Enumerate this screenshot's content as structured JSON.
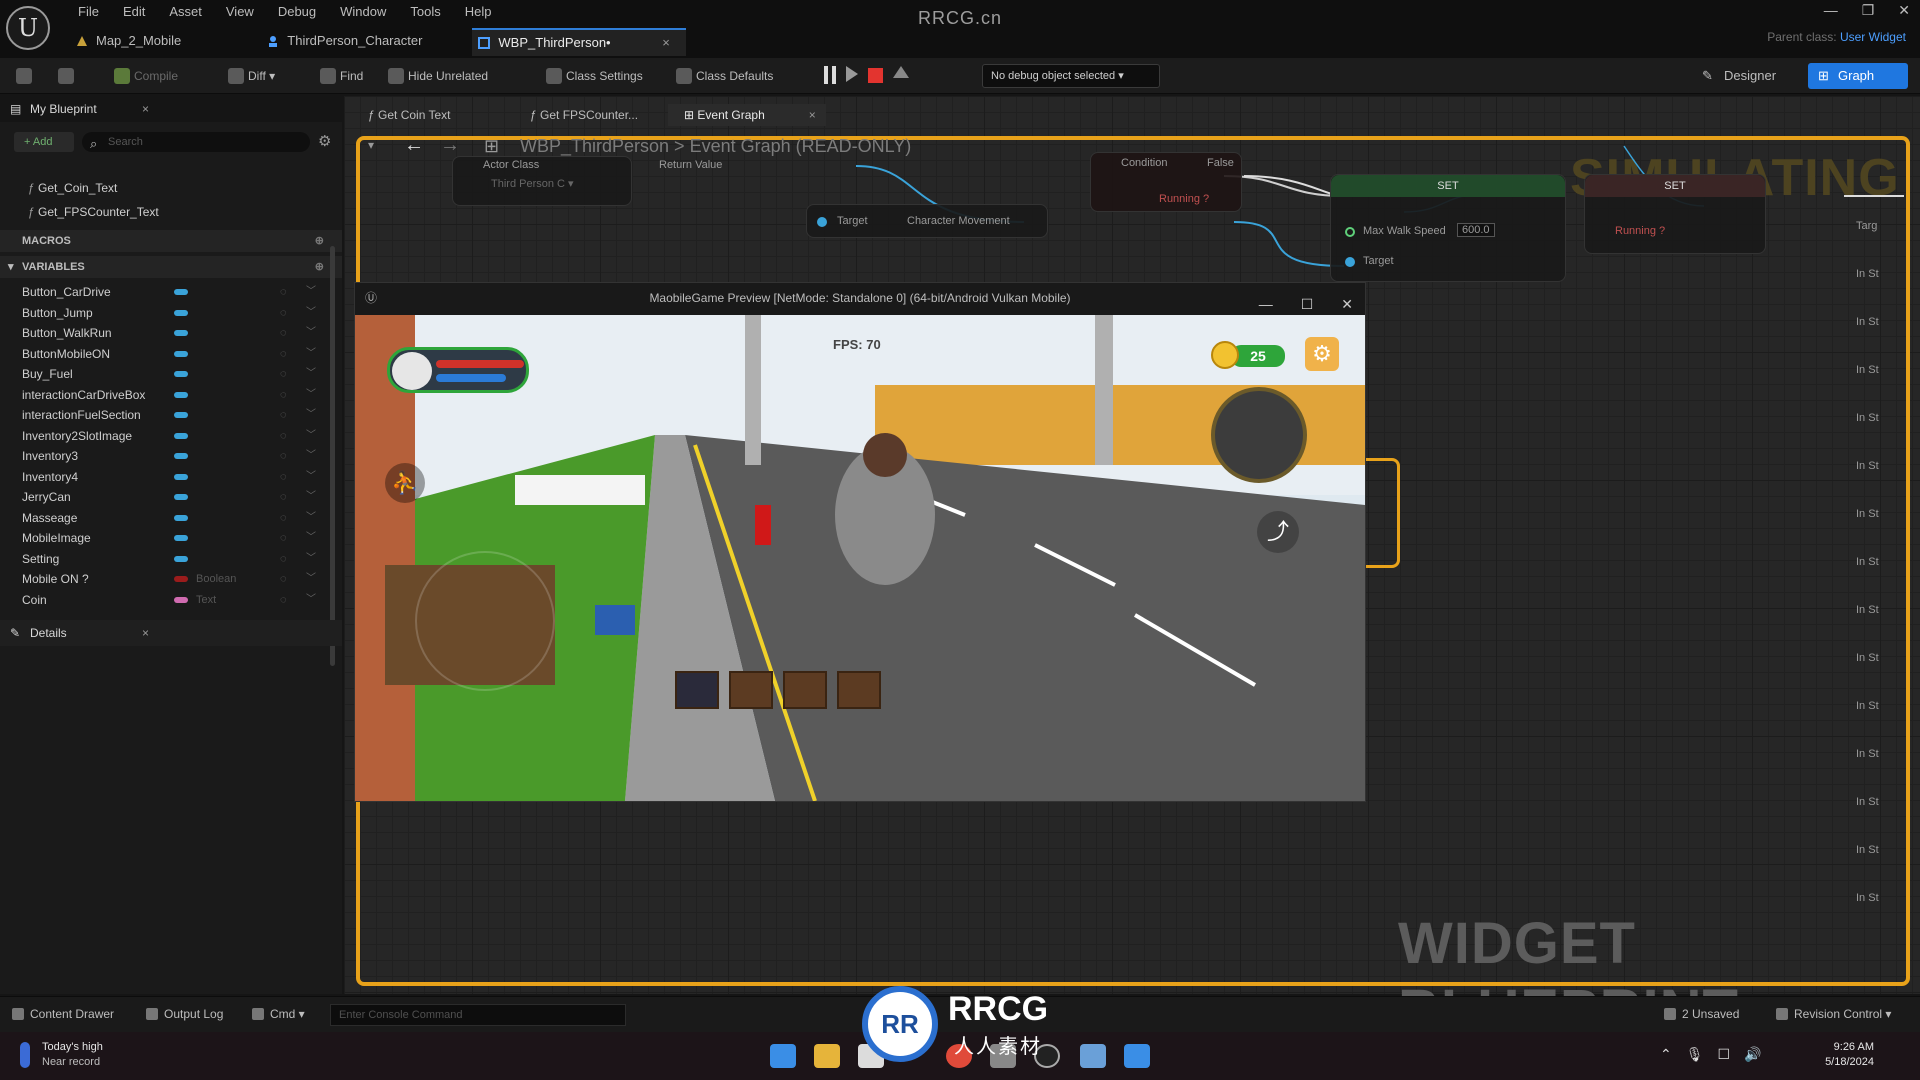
{
  "app": {
    "title": "RRCG.cn",
    "parent_class_label": "Parent class:",
    "parent_class_value": "User Widget",
    "menu": [
      "File",
      "Edit",
      "Asset",
      "View",
      "Debug",
      "Window",
      "Tools",
      "Help"
    ],
    "tabs": [
      {
        "label": "Map_2_Mobile"
      },
      {
        "label": "ThirdPerson_Character"
      },
      {
        "label": "WBP_ThirdPerson•",
        "close": "×"
      }
    ]
  },
  "toolbar": {
    "compile": "Compile",
    "diff": "Diff",
    "find": "Find",
    "hide_unrelated": "Hide Unrelated",
    "class_settings": "Class Settings",
    "class_defaults": "Class Defaults",
    "debug_object": "No debug object selected",
    "designer": "Designer",
    "graph": "Graph"
  },
  "my_blueprint": {
    "title": "My Blueprint",
    "add": "+ Add",
    "search_placeholder": "Search",
    "functions": [
      "Get_Coin_Text",
      "Get_FPSCounter_Text"
    ],
    "macros_label": "MACROS",
    "variables_label": "VARIABLES",
    "variables": [
      {
        "name": "Button_CarDrive",
        "type": ""
      },
      {
        "name": "Button_Jump",
        "type": ""
      },
      {
        "name": "Button_WalkRun",
        "type": ""
      },
      {
        "name": "ButtonMobileON",
        "type": ""
      },
      {
        "name": "Buy_Fuel",
        "type": ""
      },
      {
        "name": "interactionCarDriveBox",
        "type": ""
      },
      {
        "name": "interactionFuelSection",
        "type": ""
      },
      {
        "name": "Inventory2SlotImage",
        "type": ""
      },
      {
        "name": "Inventory3",
        "type": ""
      },
      {
        "name": "Inventory4",
        "type": ""
      },
      {
        "name": "JerryCan",
        "type": ""
      },
      {
        "name": "Masseage",
        "type": ""
      },
      {
        "name": "MobileImage",
        "type": ""
      },
      {
        "name": "Setting",
        "type": ""
      },
      {
        "name": "Mobile ON ?",
        "type": "Boolean"
      },
      {
        "name": "Coin",
        "type": "Text"
      }
    ],
    "details_title": "Details"
  },
  "graph": {
    "tabs": [
      {
        "label": "Get Coin Text"
      },
      {
        "label": "Get FPSCounter..."
      },
      {
        "label": "Event Graph",
        "close": "×"
      }
    ],
    "breadcrumb": "WBP_ThirdPerson > Event Graph   (READ-ONLY)",
    "simulating": "SIMULATING",
    "widget_blueprint": "WIDGET BLUEPRINT",
    "nodes": {
      "actor_class": "Actor Class",
      "third_person": "Third Person C ▾",
      "return_value": "Return Value",
      "condition": "Condition",
      "false": "False",
      "target": "Target",
      "character_movement": "Character Movement",
      "running": "Running ?",
      "set": "SET",
      "max_walk_speed": "Max Walk Speed",
      "speed_value": "600.0",
      "target2": "Target",
      "set2": "SET",
      "running2": "Running ?",
      "right_pins": [
        "Targ",
        "In St",
        "In St",
        "In St",
        "In St",
        "In St",
        "In St",
        "In St",
        "In St",
        "In St",
        "In St",
        "In St",
        "In St",
        "In St",
        "In St"
      ]
    }
  },
  "preview": {
    "title": "MaobileGame Preview [NetMode: Standalone 0]  (64-bit/Android Vulkan Mobile)",
    "fps": "FPS: 70",
    "coins": "25"
  },
  "statusbar": {
    "content_drawer": "Content Drawer",
    "output_log": "Output Log",
    "cmd": "Cmd",
    "console_placeholder": "Enter Console Command",
    "unsaved": "2 Unsaved",
    "revision": "Revision Control"
  },
  "taskbar": {
    "weather_title": "Today's high",
    "weather_sub": "Near record",
    "time": "9:26 AM",
    "date": "5/18/2024"
  },
  "watermark": {
    "rrcg": "RRCG",
    "sub": "人人素材"
  },
  "colors": {
    "accent": "#1f77e0",
    "sim_border": "#e8a21a",
    "pin_bool": "#9b1c1c",
    "pin_text": "#d06bb0",
    "pin_widget": "#3aa3d9"
  }
}
